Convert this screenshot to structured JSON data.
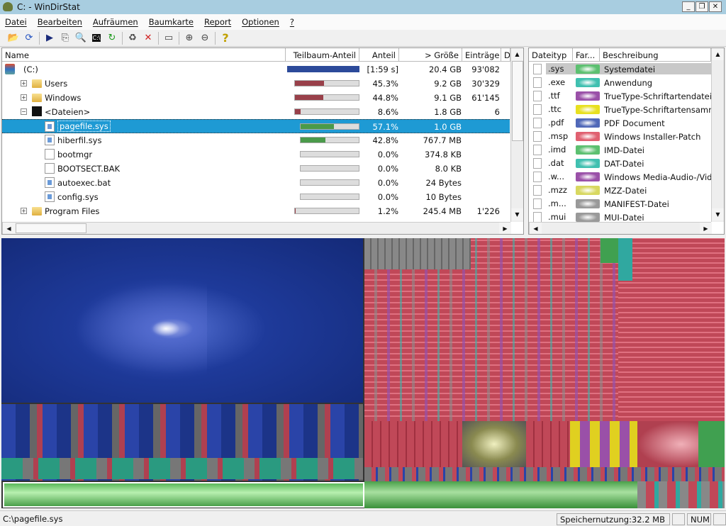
{
  "window": {
    "title": "C: - WinDirStat"
  },
  "menu": [
    "Datei",
    "Bearbeiten",
    "Aufräumen",
    "Baumkarte",
    "Report",
    "Optionen",
    "?"
  ],
  "toolbar": [
    {
      "icon": "open-folder-icon",
      "glyph": "📂"
    },
    {
      "icon": "refresh-icon",
      "glyph": "⟳"
    },
    {
      "icon": "play-icon",
      "glyph": "▶"
    },
    {
      "icon": "copy-icon",
      "glyph": "⎘"
    },
    {
      "icon": "explorer-search-icon",
      "glyph": "🔍"
    },
    {
      "icon": "command-prompt-icon",
      "glyph": "C:\\"
    },
    {
      "icon": "reload-icon",
      "glyph": "↻"
    },
    {
      "icon": "recycle-bin-icon",
      "glyph": "♻"
    },
    {
      "icon": "delete-icon",
      "glyph": "✕"
    },
    {
      "icon": "properties-folder-icon",
      "glyph": "▭"
    },
    {
      "icon": "zoom-in-icon",
      "glyph": "⊕"
    },
    {
      "icon": "zoom-out-icon",
      "glyph": "⊖"
    },
    {
      "icon": "help-icon",
      "glyph": "?"
    }
  ],
  "tree": {
    "columns": [
      "Name",
      "Teilbaum-Anteil",
      "Anteil",
      "> Größe",
      "Einträge",
      "D"
    ],
    "rows": [
      {
        "name": "(C:)",
        "icon": "drive-icon",
        "indent": 0,
        "expander": "",
        "bar": 1.0,
        "barcolor": "#2c4a9a",
        "share": "[1:59 s]",
        "size": "20.4 GB",
        "items": "93'082"
      },
      {
        "name": "Users",
        "icon": "folder-icon",
        "indent": 1,
        "expander": "+",
        "bar": 0.453,
        "barcolor": "#99404a",
        "share": "45.3%",
        "size": "9.2 GB",
        "items": "30'329"
      },
      {
        "name": "Windows",
        "icon": "folder-icon",
        "indent": 1,
        "expander": "+",
        "bar": 0.448,
        "barcolor": "#99404a",
        "share": "44.8%",
        "size": "9.1 GB",
        "items": "61'145"
      },
      {
        "name": "<Dateien>",
        "icon": "files-icon",
        "indent": 1,
        "expander": "−",
        "bar": 0.086,
        "barcolor": "#99404a",
        "share": "8.6%",
        "size": "1.8 GB",
        "items": "6"
      },
      {
        "name": "pagefile.sys",
        "icon": "system-file-icon",
        "indent": 2,
        "expander": "",
        "bar": 0.571,
        "barcolor": "#4a9a4a",
        "share": "57.1%",
        "size": "1.0 GB",
        "items": "",
        "selected": true
      },
      {
        "name": "hiberfil.sys",
        "icon": "system-file-icon",
        "indent": 2,
        "expander": "",
        "bar": 0.428,
        "barcolor": "#4a9a4a",
        "share": "42.8%",
        "size": "767.7 MB",
        "items": ""
      },
      {
        "name": "bootmgr",
        "icon": "file-icon",
        "indent": 2,
        "expander": "",
        "bar": 0,
        "barcolor": "#4a9a4a",
        "share": "0.0%",
        "size": "374.8 KB",
        "items": ""
      },
      {
        "name": "BOOTSECT.BAK",
        "icon": "file-icon",
        "indent": 2,
        "expander": "",
        "bar": 0,
        "barcolor": "#4a9a4a",
        "share": "0.0%",
        "size": "8.0 KB",
        "items": ""
      },
      {
        "name": "autoexec.bat",
        "icon": "system-file-icon",
        "indent": 2,
        "expander": "",
        "bar": 0,
        "barcolor": "#4a9a4a",
        "share": "0.0%",
        "size": "24 Bytes",
        "items": ""
      },
      {
        "name": "config.sys",
        "icon": "system-file-icon",
        "indent": 2,
        "expander": "",
        "bar": 0,
        "barcolor": "#4a9a4a",
        "share": "0.0%",
        "size": "10 Bytes",
        "items": ""
      },
      {
        "name": "Program Files",
        "icon": "folder-icon",
        "indent": 1,
        "expander": "+",
        "bar": 0.012,
        "barcolor": "#99404a",
        "share": "1.2%",
        "size": "245.4 MB",
        "items": "1'226"
      }
    ]
  },
  "types": {
    "columns": [
      "Dateityp",
      "Far...",
      "Beschreibung"
    ],
    "rows": [
      {
        "ext": ".sys",
        "color": "#5cc070",
        "desc": "Systemdatei",
        "selected": true
      },
      {
        "ext": ".exe",
        "color": "#40c0b0",
        "desc": "Anwendung"
      },
      {
        "ext": ".ttf",
        "color": "#9a50a8",
        "desc": "TrueType-Schriftartendatei"
      },
      {
        "ext": ".ttc",
        "color": "#e8e020",
        "desc": "TrueType-Schriftartensamm."
      },
      {
        "ext": ".pdf",
        "color": "#5068b8",
        "desc": "PDF Document"
      },
      {
        "ext": ".msp",
        "color": "#e06070",
        "desc": "Windows Installer-Patch"
      },
      {
        "ext": ".imd",
        "color": "#5cc070",
        "desc": "IMD-Datei"
      },
      {
        "ext": ".dat",
        "color": "#40c0b0",
        "desc": "DAT-Datei"
      },
      {
        "ext": ".w...",
        "color": "#9a50a8",
        "desc": "Windows Media-Audio-/Vid."
      },
      {
        "ext": ".mzz",
        "color": "#d8d860",
        "desc": "MZZ-Datei"
      },
      {
        "ext": ".m...",
        "color": "#999999",
        "desc": "MANIFEST-Datei"
      },
      {
        "ext": ".mui",
        "color": "#999999",
        "desc": "MUI-Datei"
      }
    ]
  },
  "status": {
    "path": "C:\\pagefile.sys",
    "memory_label": "Speichernutzung:",
    "memory_value": "32.2 MB",
    "num": "NUM"
  }
}
